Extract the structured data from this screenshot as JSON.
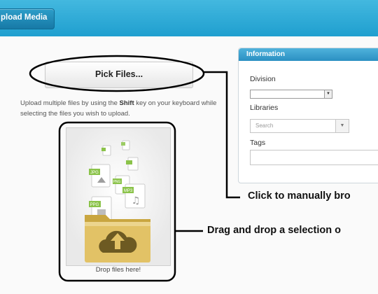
{
  "header": {
    "upload_tab_label": "pload Media"
  },
  "uploader": {
    "pick_files_label": "Pick Files...",
    "help_text_before": "Upload multiple files by using the ",
    "help_text_key": "Shift",
    "help_text_after": " key on your keyboard while selecting the files you wish to upload.",
    "drop_label": "Drop files here!",
    "file_badges": [
      "JPG",
      "PNG",
      "MP3",
      "PPG"
    ]
  },
  "info_panel": {
    "title": "Information",
    "division_label": "Division",
    "division_value": "",
    "libraries_label": "Libraries",
    "libraries_placeholder": "Search",
    "tags_label": "Tags",
    "tags_value": ""
  },
  "annotations": {
    "pick_callout": "Click to manually bro",
    "drop_callout": "Drag and drop a selection o"
  },
  "colors": {
    "header": "#2aa7d6",
    "info_header": "#3a9fcf",
    "folder": "#d8b85a"
  },
  "icons": {
    "cloud_upload": "cloud-upload-icon",
    "dropdown": "chevron-down-icon"
  }
}
